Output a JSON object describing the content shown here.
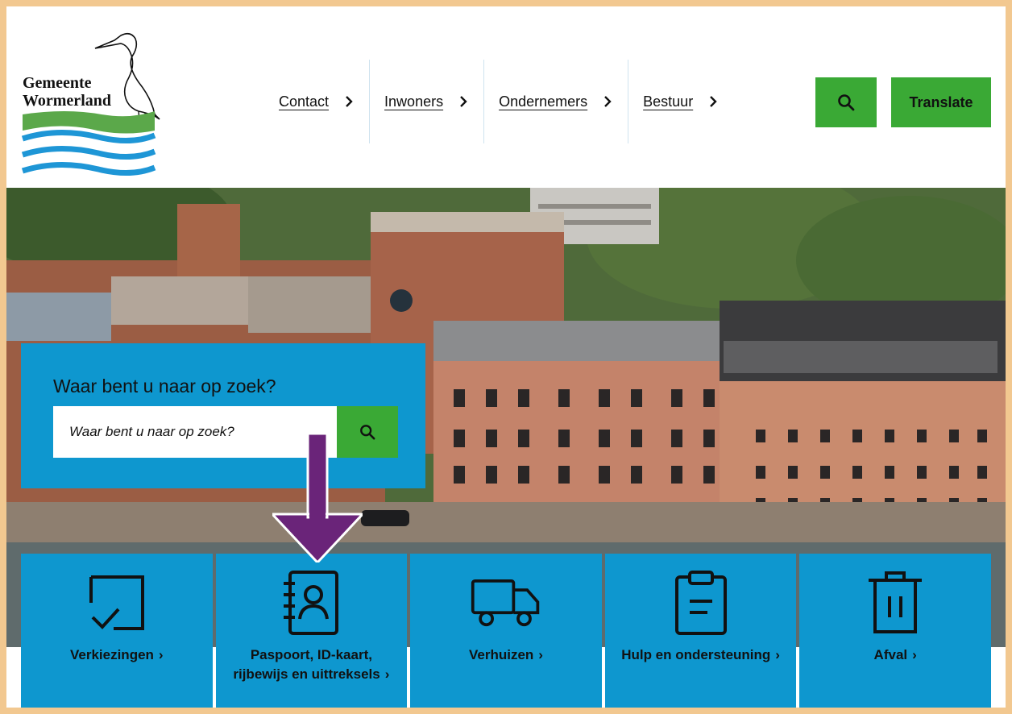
{
  "logo": {
    "line1": "Gemeente",
    "line2": "Wormerland"
  },
  "nav": [
    {
      "label": "Contact"
    },
    {
      "label": "Inwoners"
    },
    {
      "label": "Ondernemers"
    },
    {
      "label": "Bestuur"
    }
  ],
  "header": {
    "search_icon": "search-icon",
    "translate_label": "Translate"
  },
  "search": {
    "title": "Waar bent u naar op zoek?",
    "placeholder": "Waar bent u naar op zoek?",
    "button_icon": "search-icon"
  },
  "tiles": [
    {
      "label": "Verkiezingen",
      "icon": "ballot-check-icon"
    },
    {
      "label": "Paspoort, ID-kaart, rijbewijs en uittreksels",
      "icon": "contact-book-icon"
    },
    {
      "label": "Verhuizen",
      "icon": "truck-icon"
    },
    {
      "label": "Hulp en ondersteuning",
      "icon": "clipboard-icon"
    },
    {
      "label": "Afval",
      "icon": "trash-icon"
    }
  ],
  "colors": {
    "brand_blue": "#0e97cf",
    "brand_green": "#3aa935",
    "annotation_arrow": "#6a2479",
    "frame": "#f2c890"
  }
}
